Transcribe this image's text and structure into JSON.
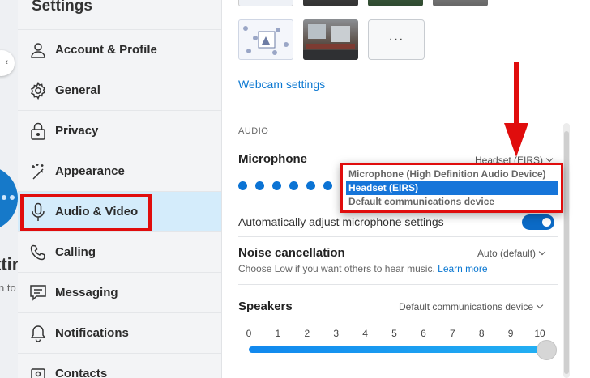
{
  "sidebar": {
    "title": "Settings",
    "items": [
      {
        "label": "Account & Profile",
        "icon": "person-icon"
      },
      {
        "label": "General",
        "icon": "gear-icon"
      },
      {
        "label": "Privacy",
        "icon": "lock-icon"
      },
      {
        "label": "Appearance",
        "icon": "magic-wand-icon"
      },
      {
        "label": "Audio & Video",
        "icon": "microphone-icon",
        "active": true
      },
      {
        "label": "Calling",
        "icon": "phone-icon"
      },
      {
        "label": "Messaging",
        "icon": "chat-icon"
      },
      {
        "label": "Notifications",
        "icon": "bell-icon"
      },
      {
        "label": "Contacts",
        "icon": "contacts-icon"
      }
    ]
  },
  "background": {
    "partial_text": "ttin",
    "partial_subtext": "n to"
  },
  "video": {
    "webcam_link": "Webcam settings",
    "more_button": "···"
  },
  "audio": {
    "section_label": "AUDIO",
    "microphone": {
      "label": "Microphone",
      "value": "Headset (EIRS)",
      "options": [
        "Microphone (High Definition Audio Device)",
        "Headset (EIRS)",
        "Default communications device"
      ],
      "selected_index": 1
    },
    "auto_adjust": {
      "label": "Automatically adjust microphone settings",
      "enabled": true
    },
    "noise": {
      "label": "Noise cancellation",
      "value": "Auto (default)",
      "help_text": "Choose Low if you want others to hear music.",
      "help_link": "Learn more"
    },
    "speakers": {
      "label": "Speakers",
      "value": "Default communications device",
      "scale": [
        "0",
        "1",
        "2",
        "3",
        "4",
        "5",
        "6",
        "7",
        "8",
        "9",
        "10"
      ],
      "volume": 10
    }
  },
  "colors": {
    "accent": "#0b73d4",
    "link": "#0a77d1",
    "annotation": "#e00d0d",
    "active_nav": "#d4ecfb"
  }
}
